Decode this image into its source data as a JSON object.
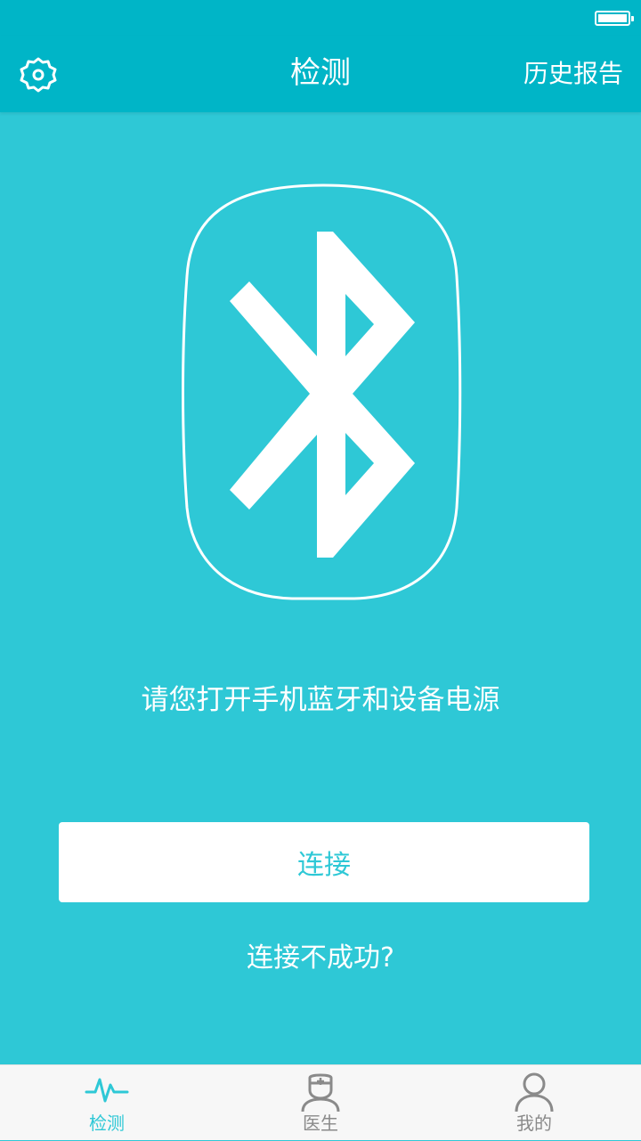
{
  "header": {
    "title": "检测",
    "history_label": "历史报告"
  },
  "main": {
    "instruction": "请您打开手机蓝牙和设备电源",
    "connect_label": "连接",
    "help_label": "连接不成功?"
  },
  "tabs": [
    {
      "label": "检测",
      "icon": "heartbeat-icon",
      "active": true
    },
    {
      "label": "医生",
      "icon": "doctor-icon",
      "active": false
    },
    {
      "label": "我的",
      "icon": "user-icon",
      "active": false
    }
  ],
  "colors": {
    "background": "#2ec8d6",
    "header": "#00b5c7",
    "tab_active": "#2ec8d6",
    "tab_inactive": "#8a8a8a"
  }
}
